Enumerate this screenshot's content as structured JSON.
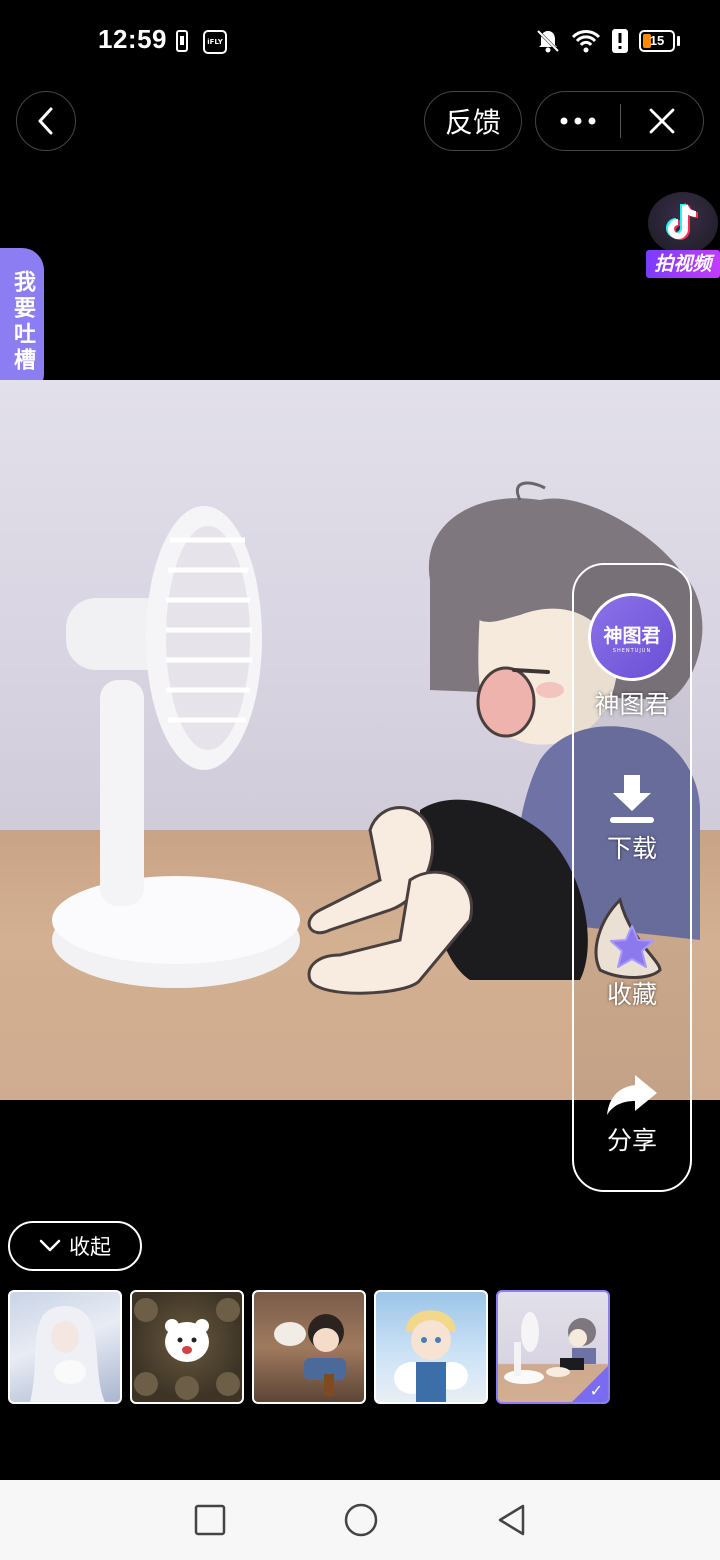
{
  "status_bar": {
    "time": "12:59",
    "battery_level": "15",
    "icons": [
      "battery-saver-icon",
      "ifly-icon",
      "mute-bell-icon",
      "wifi-icon",
      "alert-icon",
      "battery-icon"
    ]
  },
  "top_nav": {
    "back_icon": "chevron-left-icon",
    "feedback_label": "反馈",
    "more_icon": "more-dots-icon",
    "close_icon": "close-icon"
  },
  "side_tab": {
    "label": "我要吐槽"
  },
  "tiktok_badge": {
    "label": "拍视频"
  },
  "actions": {
    "avatar_text": "神图君",
    "avatar_subtext": "SHENTUJUN",
    "profile_label": "神图君",
    "download_label": "下载",
    "favorite_label": "收藏",
    "share_label": "分享"
  },
  "collapse": {
    "label": "收起"
  },
  "thumbnails": [
    {
      "subject": "white-haired girl with cat"
    },
    {
      "subject": "white bear among brown bears"
    },
    {
      "subject": "boy eating by the window"
    },
    {
      "subject": "blonde boy hugging cats"
    },
    {
      "subject": "boy sitting by fan",
      "selected": true
    }
  ],
  "colors": {
    "accent": "#8c7df2",
    "background": "#000000",
    "navbar": "#f7f7f7"
  }
}
